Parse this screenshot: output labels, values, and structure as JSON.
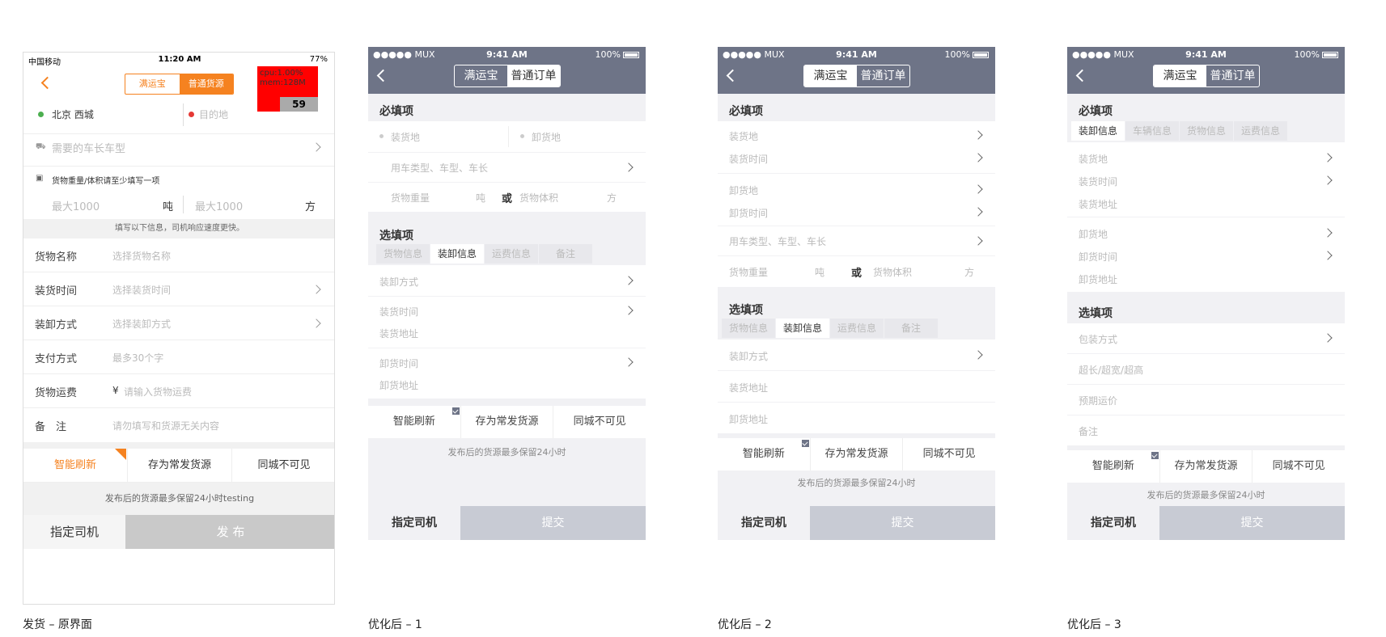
{
  "s0": {
    "status": {
      "carrier": "中国移动",
      "time": "11:20 AM",
      "battery": "77%"
    },
    "seg": [
      "满运宝",
      "普通货源"
    ],
    "debug": {
      "cpu": "cpu:1.00%",
      "mem": "mem:128M",
      "fps": "59"
    },
    "origin": "北京 西城",
    "dest_placeholder": "目的地",
    "vehicle_placeholder": "需要的车长车型",
    "weight_hint": "货物重量/体积请至少填写一项",
    "weight_placeholder": "最大1000",
    "weight_unit": "吨",
    "volume_placeholder": "最大1000",
    "volume_unit": "方",
    "info_hint": "填写以下信息，司机响应速度更快。",
    "rows": [
      {
        "label": "货物名称",
        "placeholder": "选择货物名称"
      },
      {
        "label": "装货时间",
        "placeholder": "选择装货时间"
      },
      {
        "label": "装卸方式",
        "placeholder": "选择装卸方式"
      },
      {
        "label": "支付方式",
        "placeholder": "最多30个字"
      },
      {
        "label": "货物运费",
        "placeholder": "请输入货物运费",
        "prefix": "¥"
      },
      {
        "label": "备　注",
        "placeholder": "请勿填写和货源无关内容"
      }
    ],
    "options": [
      "智能刷新",
      "存为常发货源",
      "同城不可见"
    ],
    "retain_note": "发布后的货源最多保留24小时testing",
    "btn_driver": "指定司机",
    "btn_submit": "发 布",
    "caption": "发货 – 原界面"
  },
  "common": {
    "status": {
      "carrier": "●●●●● MUX",
      "time": "9:41 AM",
      "battery": "100%"
    },
    "seg": [
      "满运宝",
      "普通订单"
    ],
    "required": "必填项",
    "optional": "选填项",
    "load_place": "装货地",
    "unload_place": "卸货地",
    "load_time": "装货时间",
    "unload_time": "卸货时间",
    "load_addr": "装货地址",
    "unload_addr": "卸货地址",
    "vehicle": "用车类型、车型、车长",
    "weight": "货物重量",
    "ton": "吨",
    "or": "或",
    "volume": "货物体积",
    "fang": "方",
    "tabs": [
      "货物信息",
      "装卸信息",
      "运费信息",
      "备注"
    ],
    "handling": "装卸方式",
    "options": [
      "智能刷新",
      "存为常发货源",
      "同城不可见"
    ],
    "retain_note": "发布后的货源最多保留24小时",
    "btn_driver": "指定司机",
    "btn_submit": "提交"
  },
  "s3": {
    "tabs": [
      "装卸信息",
      "车辆信息",
      "货物信息",
      "运费信息"
    ],
    "packing": "包装方式",
    "oversize": "超长/超宽/超高",
    "price": "预期运价",
    "remark": "备注"
  },
  "captions": {
    "s1": "优化后 – 1",
    "s2": "优化后 – 2",
    "s3": "优化后 – 3"
  }
}
